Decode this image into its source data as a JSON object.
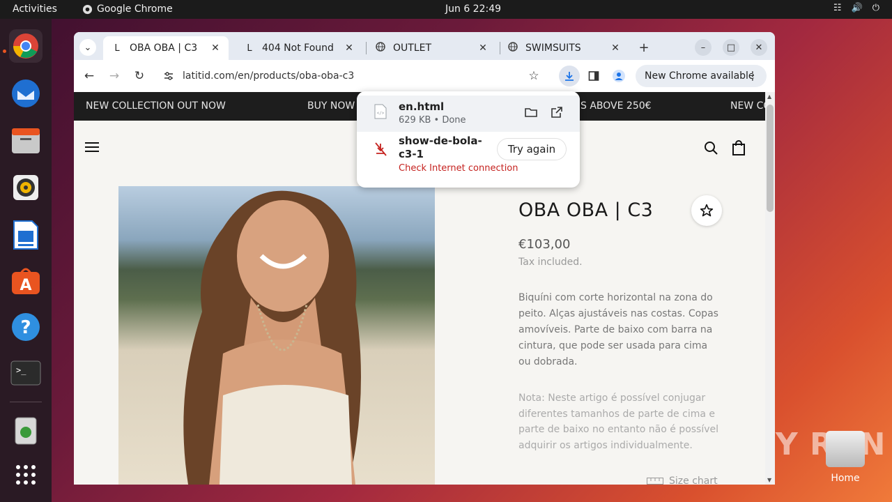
{
  "system": {
    "activities": "Activities",
    "app_name": "Google Chrome",
    "clock": "Jun 6  22:49"
  },
  "desktop": {
    "home_label": "Home",
    "watermark": "ANY RUN"
  },
  "browser": {
    "tabs": [
      {
        "title": "OBA OBA | C3",
        "favicon": "L",
        "active": true
      },
      {
        "title": "404 Not Found",
        "favicon": "L",
        "active": false
      },
      {
        "title": "OUTLET",
        "favicon": "globe-icon",
        "active": false
      },
      {
        "title": "SWIMSUITS",
        "favicon": "globe-icon",
        "active": false
      }
    ],
    "url": "latitid.com/en/products/oba-oba-c3",
    "update_label": "New Chrome available"
  },
  "downloads": {
    "items": [
      {
        "name": "en.html",
        "meta": "629 KB • Done"
      },
      {
        "name_line1": "show-de-bola-",
        "name_line2": "c3-1",
        "error": "Check Internet connection",
        "action": "Try again"
      }
    ]
  },
  "page": {
    "promo": [
      "NEW COLLECTION OUT NOW",
      "BUY NOW",
      "S ABOVE 250€",
      "NEW CO"
    ],
    "product": {
      "title": "OBA OBA | C3",
      "price": "€103,00",
      "tax": "Tax included.",
      "description": "Biquíni com corte horizontal na zona do peito. Alças ajustáveis nas costas. Copas amovíveis. Parte de baixo com barra na cintura, que pode ser usada para cima ou dobrada.",
      "note": "Nota: Neste artigo é possível conjugar diferentes tamanhos de parte de cima e parte de baixo no entanto não é possível adquirir os artigos individualmente.",
      "size_chart": "Size chart"
    }
  },
  "colors": {
    "accent": "#e95420",
    "error": "#c5221f",
    "promo_bg": "#1d1d1d"
  }
}
